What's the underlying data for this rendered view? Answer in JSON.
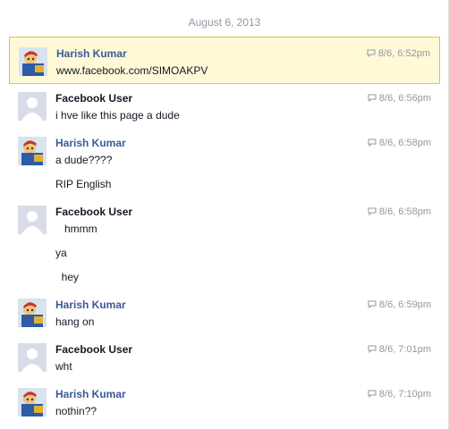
{
  "date_header": "August 6, 2013",
  "messages": [
    {
      "sender": "Harish Kumar",
      "time": "8/6, 6:52pm",
      "lines": [
        "www.facebook.com/SIMOAKPV"
      ]
    },
    {
      "sender": "Facebook User",
      "time": "8/6, 6:56pm",
      "lines": [
        "i hve like this page a dude"
      ]
    },
    {
      "sender": "Harish Kumar",
      "time": "8/6, 6:58pm",
      "lines": [
        "a dude????",
        "RIP English"
      ]
    },
    {
      "sender": "Facebook User",
      "time": "8/6, 6:58pm",
      "lines": [
        "   hmmm",
        "ya",
        "  hey"
      ]
    },
    {
      "sender": "Harish Kumar",
      "time": "8/6, 6:59pm",
      "lines": [
        "hang on"
      ]
    },
    {
      "sender": "Facebook User",
      "time": "8/6, 7:01pm",
      "lines": [
        "wht"
      ]
    },
    {
      "sender": "Harish Kumar",
      "time": "8/6, 7:10pm",
      "lines": [
        "nothin??"
      ]
    }
  ],
  "colors": {
    "name_link": "#3b5998",
    "highlight_bg": "#fff9d7",
    "highlight_border": "#e2c822",
    "meta_gray": "#9197a3"
  },
  "icons": {
    "timestamp": "speech-bubble-icon",
    "harish_avatar": "cartoon-avatar",
    "fb_user_avatar": "default-silhouette-avatar"
  }
}
